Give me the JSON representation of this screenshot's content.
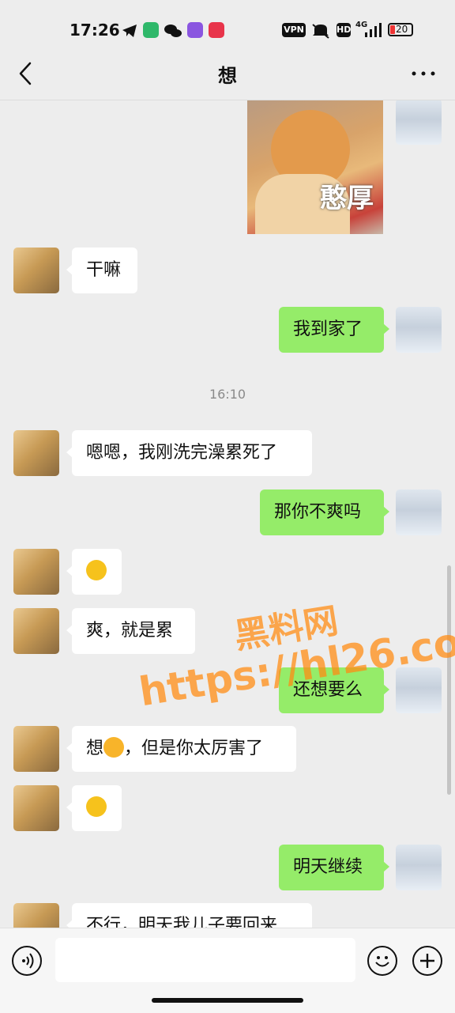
{
  "status_bar": {
    "time": "17:26",
    "vpn": "VPN",
    "hd": "HD",
    "network": "4G",
    "battery": "20"
  },
  "header": {
    "title": "想"
  },
  "sticker": {
    "caption": "憨厚"
  },
  "messages": [
    {
      "side": "in",
      "text": "干嘛"
    },
    {
      "side": "out",
      "text": "我到家了"
    },
    {
      "side": "in",
      "text": "嗯嗯，我刚洗完澡累死了"
    },
    {
      "side": "out",
      "text": "那你不爽吗"
    },
    {
      "side": "in",
      "emoji": "flushed-emoji"
    },
    {
      "side": "in",
      "text": "爽，就是累"
    },
    {
      "side": "out",
      "text": "还想要么"
    },
    {
      "side": "in",
      "text_a": "想",
      "emoji": "heart-eyes-emoji",
      "text_b": "，但是你太厉害了"
    },
    {
      "side": "in",
      "emoji": "flushed-emoji"
    },
    {
      "side": "out",
      "text": "明天继续"
    },
    {
      "side": "in",
      "text": "不行，明天我儿子要回来"
    }
  ],
  "timestamp": "16:10",
  "watermark": {
    "line1": "黑料网",
    "line2": "https://hl26.co"
  },
  "icons": {
    "back": "chevron-left-icon",
    "more": "more-dots-icon",
    "voice": "voice-icon",
    "emoji": "emoji-icon",
    "plus": "plus-icon"
  }
}
